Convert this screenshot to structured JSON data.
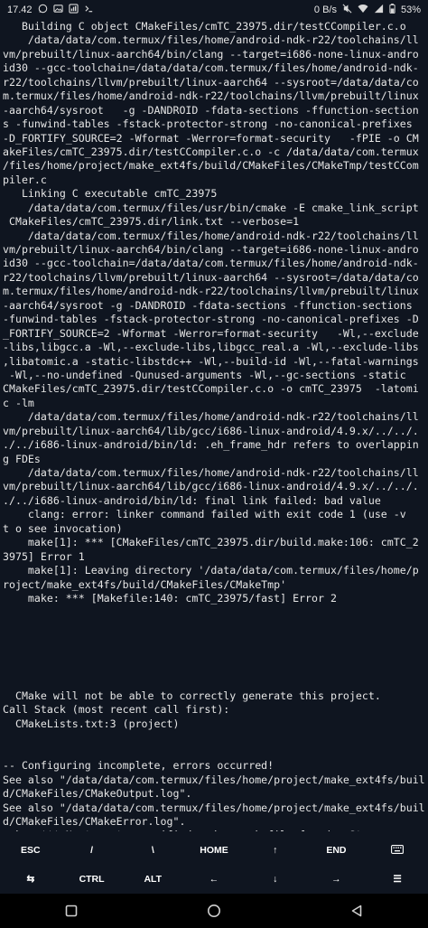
{
  "status_bar": {
    "time": "17.42",
    "net_speed": "0 B/s",
    "battery": "53%",
    "left_icons": [
      "whatsapp-icon",
      "gallery-icon",
      "data-usage-icon",
      "terminal-icon"
    ],
    "right_icons": [
      "mute-icon",
      "wifi-icon",
      "signal-icon",
      "battery-icon"
    ]
  },
  "terminal": {
    "lines": [
      "   Building C object CMakeFiles/cmTC_23975.dir/testCCompiler.c.o",
      "    /data/data/com.termux/files/home/android-ndk-r22/toolchains/ll",
      "vm/prebuilt/linux-aarch64/bin/clang --target=i686-none-linux-andro",
      "id30 --gcc-toolchain=/data/data/com.termux/files/home/android-ndk-",
      "r22/toolchains/llvm/prebuilt/linux-aarch64 --sysroot=/data/data/co",
      "m.termux/files/home/android-ndk-r22/toolchains/llvm/prebuilt/linux",
      "-aarch64/sysroot   -g -DANDROID -fdata-sections -ffunction-section",
      "s -funwind-tables -fstack-protector-strong -no-canonical-prefixes",
      "-D_FORTIFY_SOURCE=2 -Wformat -Werror=format-security   -fPIE -o CM",
      "akeFiles/cmTC_23975.dir/testCCompiler.c.o -c /data/data/com.termux",
      "/files/home/project/make_ext4fs/build/CMakeFiles/CMakeTmp/testCCom",
      "piler.c",
      "   Linking C executable cmTC_23975",
      "    /data/data/com.termux/files/usr/bin/cmake -E cmake_link_script",
      " CMakeFiles/cmTC_23975.dir/link.txt --verbose=1",
      "    /data/data/com.termux/files/home/android-ndk-r22/toolchains/ll",
      "vm/prebuilt/linux-aarch64/bin/clang --target=i686-none-linux-andro",
      "id30 --gcc-toolchain=/data/data/com.termux/files/home/android-ndk-",
      "r22/toolchains/llvm/prebuilt/linux-aarch64 --sysroot=/data/data/co",
      "m.termux/files/home/android-ndk-r22/toolchains/llvm/prebuilt/linux",
      "-aarch64/sysroot -g -DANDROID -fdata-sections -ffunction-sections",
      "-funwind-tables -fstack-protector-strong -no-canonical-prefixes -D",
      "_FORTIFY_SOURCE=2 -Wformat -Werror=format-security   -Wl,--exclude",
      "-libs,libgcc.a -Wl,--exclude-libs,libgcc_real.a -Wl,--exclude-libs",
      ",libatomic.a -static-libstdc++ -Wl,--build-id -Wl,--fatal-warnings",
      " -Wl,--no-undefined -Qunused-arguments -Wl,--gc-sections -static",
      "CMakeFiles/cmTC_23975.dir/testCCompiler.c.o -o cmTC_23975  -latomi",
      "c -lm",
      "    /data/data/com.termux/files/home/android-ndk-r22/toolchains/ll",
      "vm/prebuilt/linux-aarch64/lib/gcc/i686-linux-android/4.9.x/../../.",
      "./../i686-linux-android/bin/ld: .eh_frame_hdr refers to overlappin",
      "g FDEs",
      "    /data/data/com.termux/files/home/android-ndk-r22/toolchains/ll",
      "vm/prebuilt/linux-aarch64/lib/gcc/i686-linux-android/4.9.x/../../.",
      "./../i686-linux-android/bin/ld: final link failed: bad value",
      "    clang: error: linker command failed with exit code 1 (use -v",
      "t o see invocation)",
      "    make[1]: *** [CMakeFiles/cmTC_23975.dir/build.make:106: cmTC_2",
      "3975] Error 1",
      "    make[1]: Leaving directory '/data/data/com.termux/files/home/p",
      "roject/make_ext4fs/build/CMakeFiles/CMakeTmp'",
      "    make: *** [Makefile:140: cmTC_23975/fast] Error 2",
      "",
      "",
      "",
      "",
      "",
      "",
      "  CMake will not be able to correctly generate this project.",
      "Call Stack (most recent call first):",
      "  CMakeLists.txt:3 (project)",
      "",
      "",
      "-- Configuring incomplete, errors occurred!",
      "See also \"/data/data/com.termux/files/home/project/make_ext4fs/buil",
      "d/CMakeFiles/CMakeOutput.log\".",
      "See also \"/data/data/com.termux/files/home/project/make_ext4fs/buil",
      "d/CMakeFiles/CMakeError.log\".",
      "make: *** No targets specified and no makefile found.  Stop."
    ]
  },
  "extra_keys": {
    "row1": [
      {
        "label": "ESC",
        "name": "key-esc"
      },
      {
        "label": "/",
        "name": "key-slash"
      },
      {
        "label": "\\",
        "name": "key-backslash"
      },
      {
        "label": "HOME",
        "name": "key-home"
      },
      {
        "label": "↑",
        "name": "key-up"
      },
      {
        "label": "END",
        "name": "key-end"
      },
      {
        "label": "",
        "name": "key-keyboard",
        "icon": "keyboard-icon"
      }
    ],
    "row2": [
      {
        "label": "⇆",
        "name": "key-tab"
      },
      {
        "label": "CTRL",
        "name": "key-ctrl"
      },
      {
        "label": "ALT",
        "name": "key-alt"
      },
      {
        "label": "←",
        "name": "key-left"
      },
      {
        "label": "↓",
        "name": "key-down"
      },
      {
        "label": "→",
        "name": "key-right"
      },
      {
        "label": "☰",
        "name": "key-menu"
      }
    ]
  },
  "nav_bar": {
    "icons": [
      "recents-icon",
      "home-icon",
      "back-icon"
    ]
  },
  "colors": {
    "background": "#0f1520",
    "text": "#e6e6e6",
    "nav_background": "#000000"
  }
}
